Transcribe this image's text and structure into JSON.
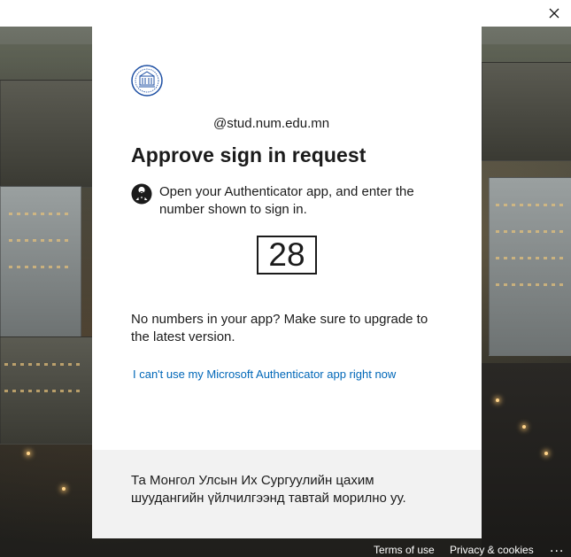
{
  "window": {
    "close_icon": "close-icon"
  },
  "signin": {
    "username": "@stud.num.edu.mn",
    "title": "Approve sign in request",
    "instruction": "Open your Authenticator app, and enter the number shown to sign in.",
    "number": "28",
    "hint": "No numbers in your app? Make sure to upgrade to the latest version.",
    "alt_link": "I can't use my Microsoft Authenticator app right now",
    "logo_icon": "university-seal-logo",
    "auth_icon": "authenticator-lock-icon"
  },
  "banner": {
    "text": "Та Монгол Улсын Их Сургуулийн цахим шуудангийн үйлчилгээнд тавтай морилно уу."
  },
  "footer": {
    "terms": "Terms of use",
    "privacy": "Privacy & cookies",
    "more": "..."
  },
  "colors": {
    "link": "#0067b8",
    "banner_bg": "#f2f2f2",
    "text": "#1b1b1b"
  }
}
